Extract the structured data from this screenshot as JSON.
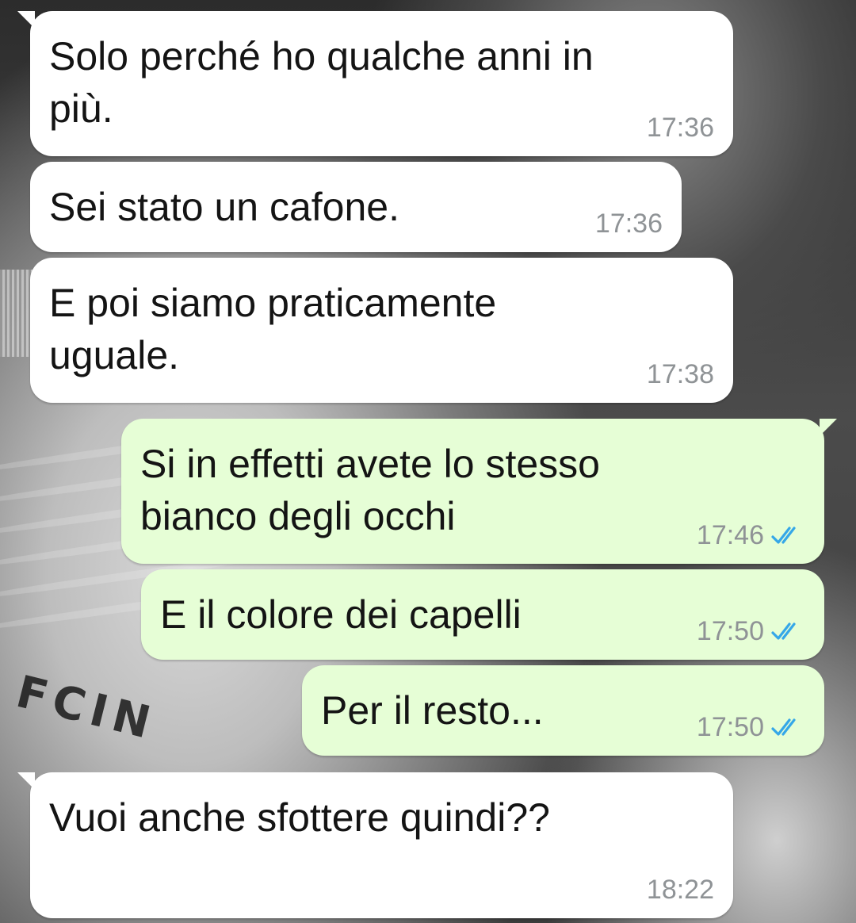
{
  "colors": {
    "incoming_bubble": "#ffffff",
    "outgoing_bubble": "#e6fed6",
    "timestamp": "#8f9396",
    "read_ticks": "#35a7e8"
  },
  "background": {
    "brand_text": "FCIN"
  },
  "messages": [
    {
      "direction": "incoming",
      "text": "Solo perché ho qualche anni in\npiù.",
      "time": "17:36"
    },
    {
      "direction": "incoming",
      "text": "Sei stato un cafone.",
      "time": "17:36"
    },
    {
      "direction": "incoming",
      "text": "E poi siamo praticamente\nuguale.",
      "time": "17:38"
    },
    {
      "direction": "outgoing",
      "text": "Si in effetti avete lo stesso\nbianco degli occhi",
      "time": "17:46",
      "status": "read",
      "status_icon": "double-check-icon"
    },
    {
      "direction": "outgoing",
      "text": "E il colore dei capelli",
      "time": "17:50",
      "status": "read",
      "status_icon": "double-check-icon"
    },
    {
      "direction": "outgoing",
      "text": "Per il resto...",
      "time": "17:50",
      "status": "read",
      "status_icon": "double-check-icon"
    },
    {
      "direction": "incoming",
      "text": "Vuoi anche sfottere quindi??",
      "time": "18:22"
    }
  ]
}
